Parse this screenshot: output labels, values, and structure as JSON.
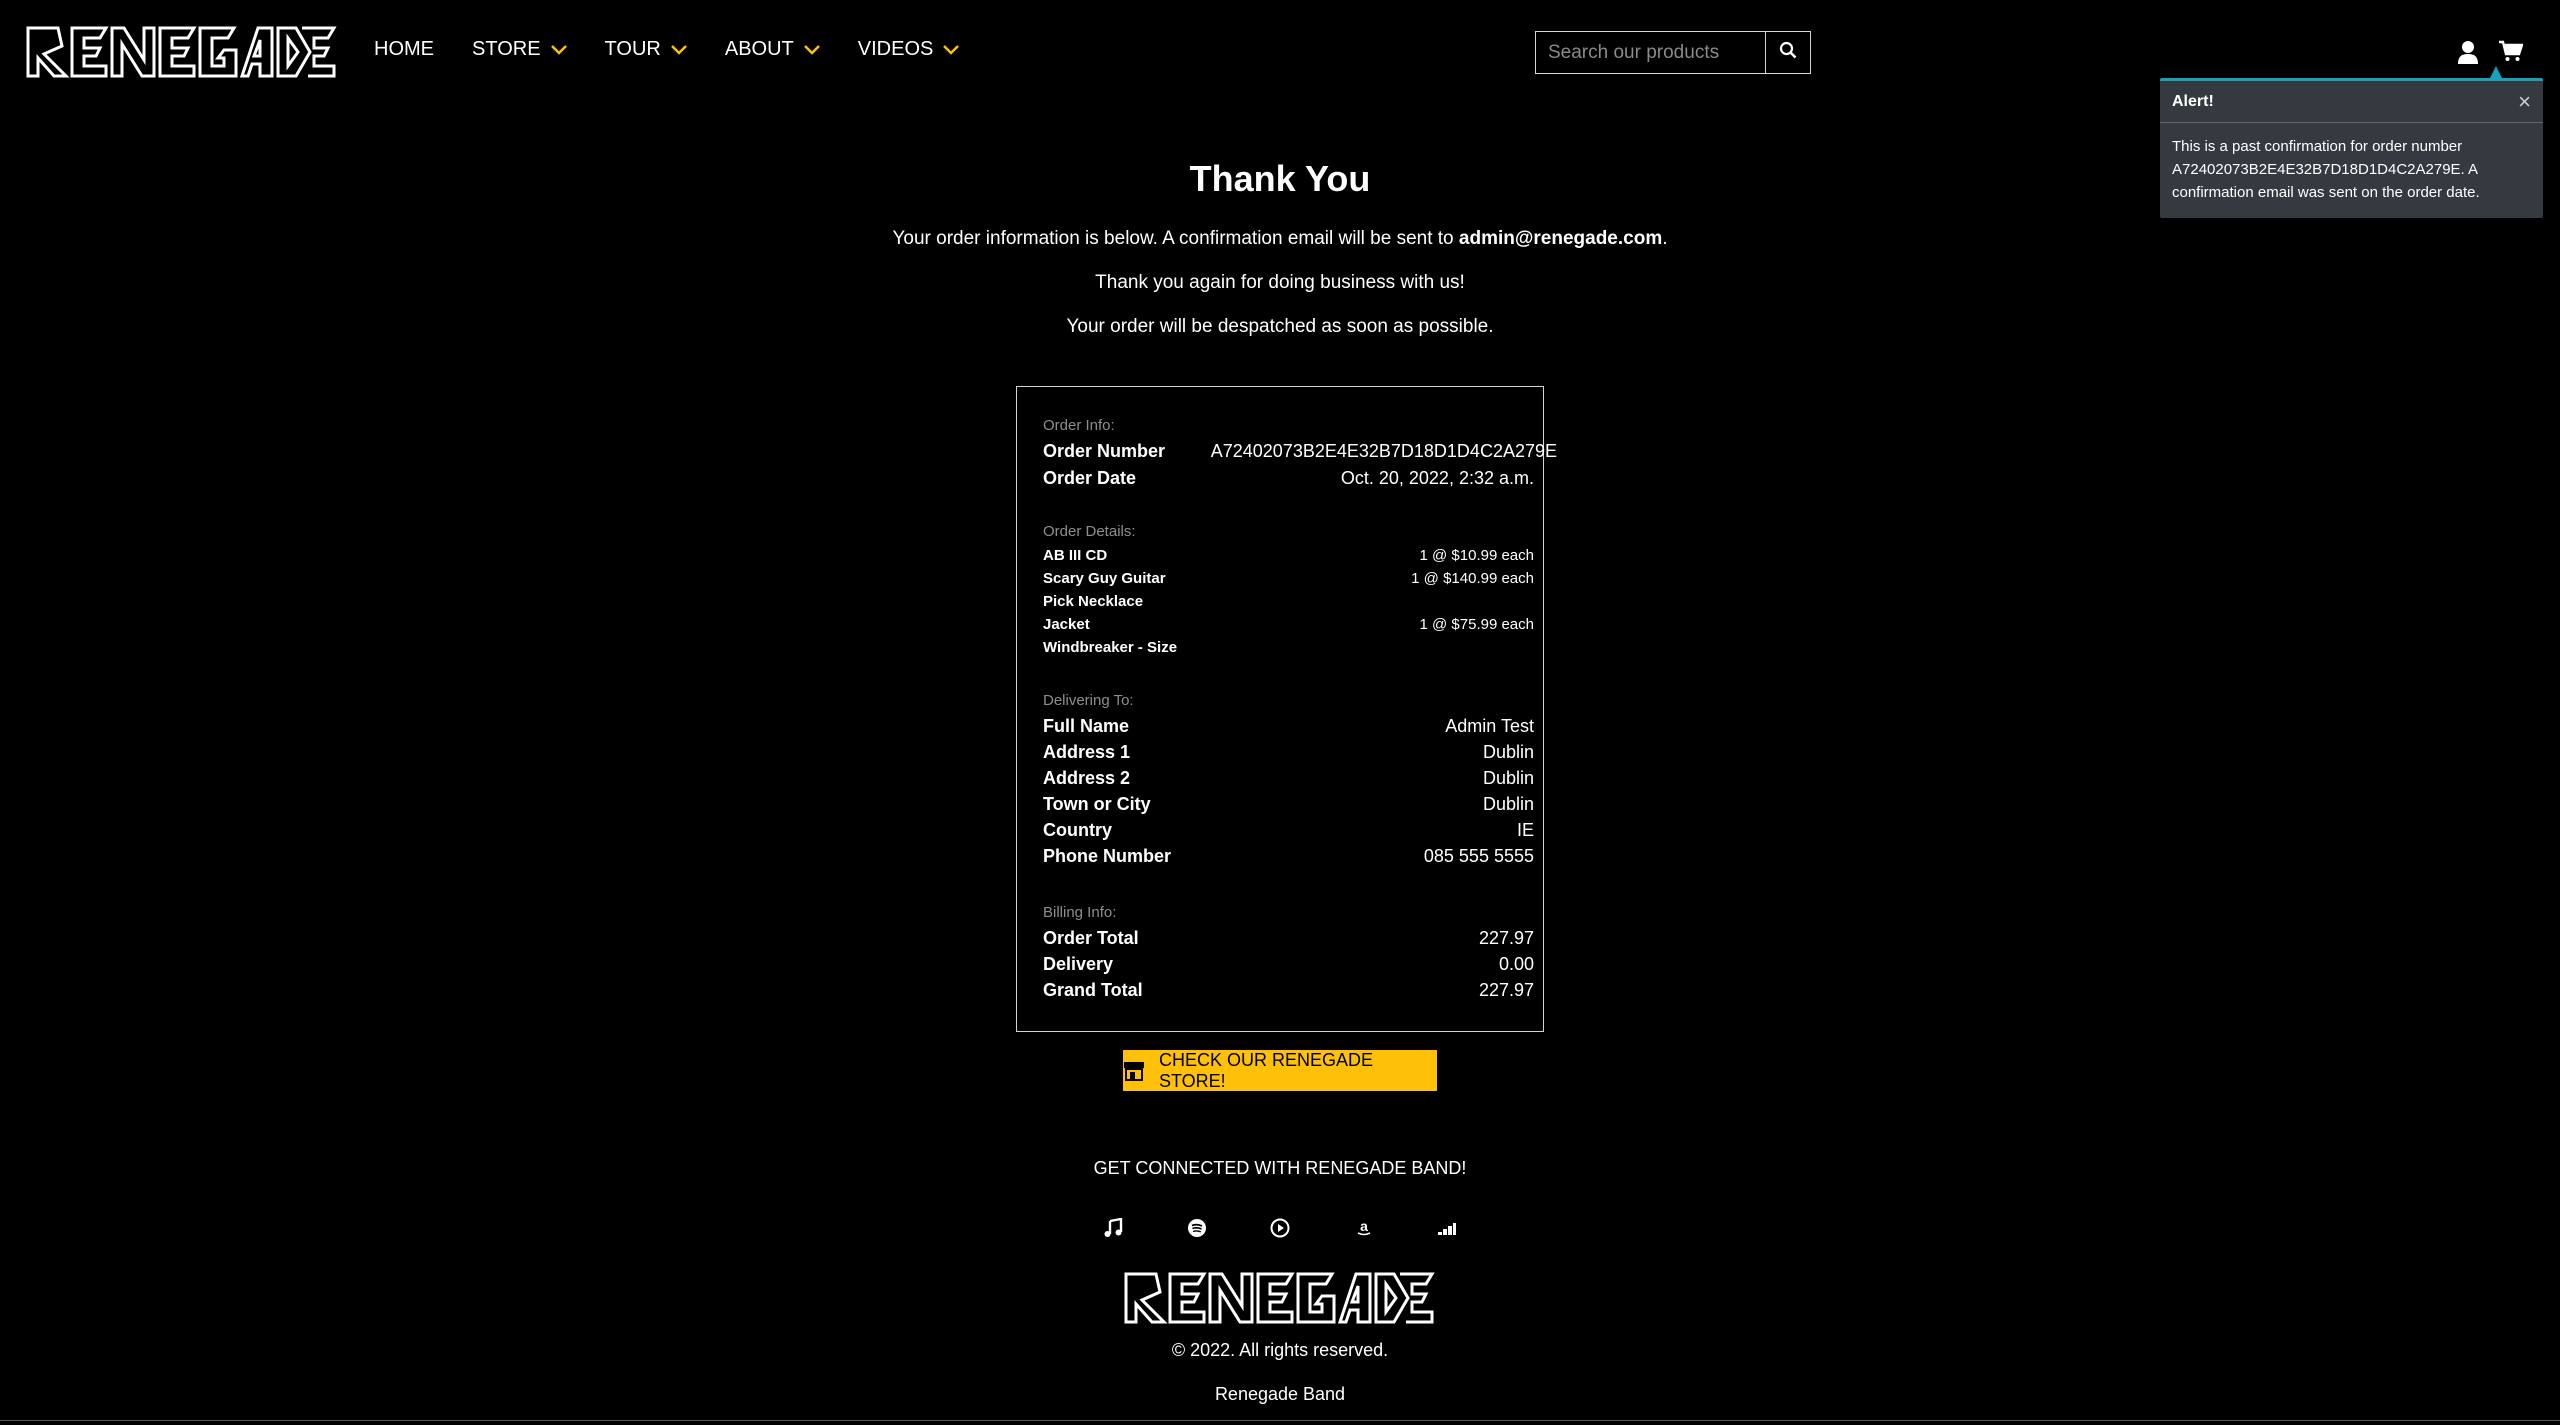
{
  "brand": {
    "logo_text": "RENEGADE"
  },
  "nav": {
    "items": [
      {
        "label": "HOME",
        "dropdown": false
      },
      {
        "label": "STORE",
        "dropdown": true
      },
      {
        "label": "TOUR",
        "dropdown": true
      },
      {
        "label": "ABOUT",
        "dropdown": true
      },
      {
        "label": "VIDEOS",
        "dropdown": true
      }
    ]
  },
  "search": {
    "placeholder": "Search our products"
  },
  "alert": {
    "title": "Alert!",
    "message": "This is a past confirmation for order number A72402073B2E4E32B7D18D1D4C2A279E. A confirmation email was sent on the order date."
  },
  "main": {
    "title": "Thank You",
    "line1_prefix": "Your order information is below. A confirmation email will be sent to ",
    "line1_email": "admin@renegade.com",
    "line1_suffix": ".",
    "line2": "Thank you again for doing business with us!",
    "line3": "Your order will be despatched as soon as possible."
  },
  "order": {
    "info_label": "Order Info:",
    "number_key": "Order Number",
    "number_value": "A72402073B2E4E32B7D18D1D4C2A279E",
    "date_key": "Order Date",
    "date_value": "Oct. 20, 2022, 2:32 a.m.",
    "details_label": "Order Details:",
    "items": [
      {
        "name": "AB III CD",
        "qty": "1 @ $10.99 each"
      },
      {
        "name": "Scary Guy Guitar Pick Necklace",
        "name_line1": "Scary Guy Guitar",
        "name_line2": "Pick Necklace",
        "qty": "1 @ $140.99 each"
      },
      {
        "name": "Jacket Windbreaker - Size",
        "name_line1": "Jacket",
        "name_line2": "Windbreaker - Size",
        "qty": "1 @ $75.99 each"
      }
    ],
    "delivery_label": "Delivering To:",
    "delivery": [
      {
        "key": "Full Name",
        "value": "Admin Test"
      },
      {
        "key": "Address 1",
        "value": "Dublin"
      },
      {
        "key": "Address 2",
        "value": "Dublin"
      },
      {
        "key": "Town or City",
        "value": "Dublin"
      },
      {
        "key": "Country",
        "value": "IE"
      },
      {
        "key": "Phone Number",
        "value": "085 555 5555"
      }
    ],
    "billing_label": "Billing Info:",
    "billing": [
      {
        "key": "Order Total",
        "value": "227.97"
      },
      {
        "key": "Delivery",
        "value": "0.00"
      },
      {
        "key": "Grand Total",
        "value": "227.97"
      }
    ]
  },
  "store_button": {
    "label": "CHECK OUR RENEGADE STORE!",
    "icon": "store-icon"
  },
  "footer": {
    "connect": "GET CONNECTED WITH RENEGADE BAND!",
    "socials": [
      "music-note-icon",
      "spotify-icon",
      "play-circle-icon",
      "amazon-icon",
      "deezer-icon"
    ],
    "copyright": "© 2022. All rights reserved.",
    "band": "Renegade Band"
  },
  "colors": {
    "background": "#000000",
    "accent": "#ffc107",
    "alert_bg": "#343a40",
    "alert_border": "#17a2b8"
  }
}
